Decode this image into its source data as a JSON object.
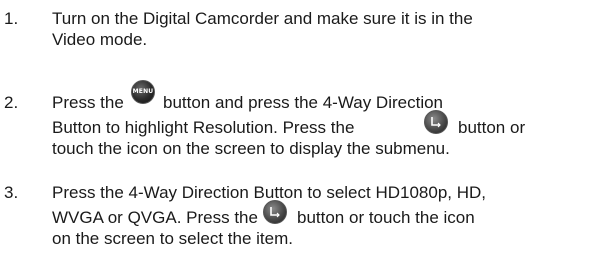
{
  "steps": [
    {
      "number": "1.",
      "lines": [
        "Turn on the Digital Camcorder and make sure it is in the",
        "Video mode."
      ]
    },
    {
      "number": "2.",
      "lines": [
        "Press the",
        "button and press the 4-Way Direction",
        "Button to highlight Resolution. Press the",
        "button or",
        "touch the icon on the screen to display the submenu."
      ]
    },
    {
      "number": "3.",
      "lines": [
        "Press the 4-Way Direction Button to select HD1080p, HD,",
        "WVGA or QVGA. Press the",
        "button or touch the icon",
        "on the screen to select the item."
      ]
    }
  ],
  "icons": {
    "menu_button_label": "MENU",
    "menu_button_icon": "menu-button-icon",
    "ok_button_icon": "ok-button-icon"
  }
}
